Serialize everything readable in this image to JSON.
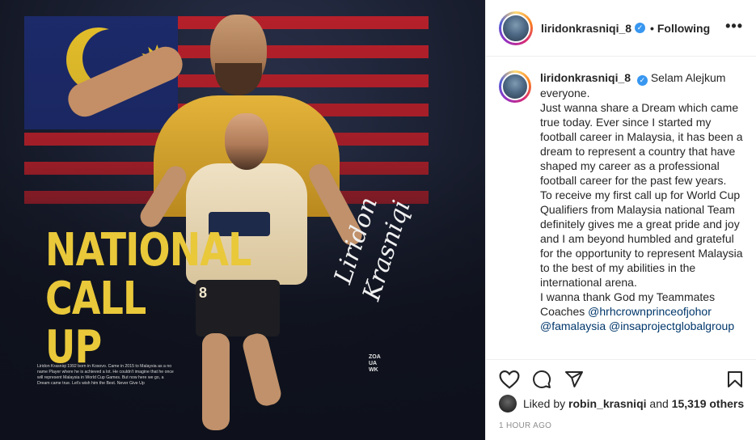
{
  "post": {
    "image": {
      "headline": "NATIONAL CALL UP",
      "signature": "Liridon Krasniqi",
      "jersey_number": "8",
      "bio": "Liridon Krasniqi 1992 born in Kosovo. Came in 2015 to Malaysia as a no name Player where he is achieved a lot. He couldn't imagine that he once will represent Malaysia in World Cup Games. But now here we go, a Dream came true. Let's wish him the Best. Never Give Up",
      "watermark": "ZOA UA WK"
    },
    "header": {
      "username": "liridonkrasniqi_8",
      "separator": "•",
      "follow_label": "Following",
      "more_label": "•••"
    },
    "caption": {
      "username": "liridonkrasniqi_8",
      "paragraphs": [
        "Selam Alejkum everyone.",
        "Just wanna share a Dream which came true today. Ever since I started my football career in Malaysia, it has been a dream to represent a country that have shaped my career as a professional football career for the past few years.",
        "To receive my first call up for World Cup Qualifiers from Malaysia national Team definitely gives me a great pride and joy and I am beyond humbled and grateful for the opportunity to represent Malaysia to the best of my abilities in the international arena.",
        "I wanna thank God my Teammates Coaches"
      ],
      "mentions": [
        "@hrhcrownprinceofjohor",
        "@famalaysia",
        "@insaprojectglobalgroup"
      ]
    },
    "actions": {
      "like": "heart-icon",
      "comment": "comment-icon",
      "share": "share-icon",
      "save": "bookmark-icon"
    },
    "likes": {
      "prefix": "Liked by",
      "user": "robin_krasniqi",
      "and": "and",
      "count": "15,319 others"
    },
    "timestamp": "1 HOUR AGO"
  },
  "colors": {
    "link": "#00376b",
    "verified": "#3897f0",
    "headline": "#e9c83a"
  }
}
